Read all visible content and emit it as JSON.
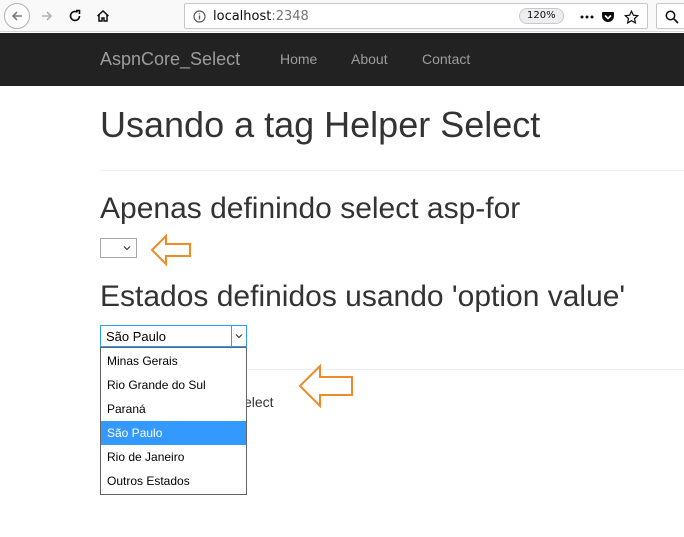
{
  "browser": {
    "url_host": "localhost",
    "url_port": ":2348",
    "zoom": "120%"
  },
  "navbar": {
    "brand": "AspnCore_Select",
    "links": [
      "Home",
      "About",
      "Contact"
    ]
  },
  "page": {
    "title": "Usando a tag Helper Select",
    "section1_heading": "Apenas definindo select asp-for",
    "section2_heading": "Estados definidos usando 'option value'",
    "partially_hidden_text": "elect"
  },
  "states_select": {
    "selected": "São Paulo",
    "options": [
      "Minas Gerais",
      "Rio Grande do Sul",
      "Paraná",
      "São Paulo",
      "Rio de Janeiro",
      "Outros Estados"
    ],
    "selected_index": 3
  },
  "colors": {
    "navbar_bg": "#222222",
    "arrow": "#f08a24",
    "highlight": "#3399ff"
  },
  "icons": [
    "back-arrow-icon",
    "forward-arrow-icon",
    "reload-icon",
    "home-icon",
    "info-icon",
    "more-icon",
    "pocket-icon",
    "star-icon",
    "search-icon",
    "chevron-down-icon",
    "left-arrow-annotation-icon"
  ]
}
